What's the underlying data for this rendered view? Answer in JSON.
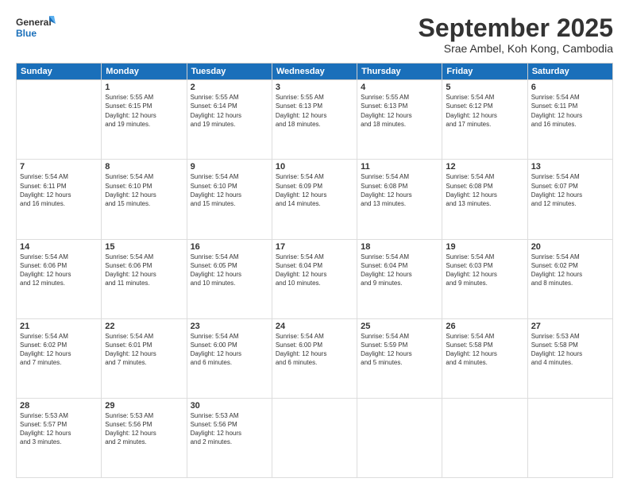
{
  "header": {
    "logo_line1": "General",
    "logo_line2": "Blue",
    "month_title": "September 2025",
    "location": "Srae Ambel, Koh Kong, Cambodia"
  },
  "weekdays": [
    "Sunday",
    "Monday",
    "Tuesday",
    "Wednesday",
    "Thursday",
    "Friday",
    "Saturday"
  ],
  "weeks": [
    [
      {
        "day": "",
        "info": ""
      },
      {
        "day": "1",
        "info": "Sunrise: 5:55 AM\nSunset: 6:15 PM\nDaylight: 12 hours\nand 19 minutes."
      },
      {
        "day": "2",
        "info": "Sunrise: 5:55 AM\nSunset: 6:14 PM\nDaylight: 12 hours\nand 19 minutes."
      },
      {
        "day": "3",
        "info": "Sunrise: 5:55 AM\nSunset: 6:13 PM\nDaylight: 12 hours\nand 18 minutes."
      },
      {
        "day": "4",
        "info": "Sunrise: 5:55 AM\nSunset: 6:13 PM\nDaylight: 12 hours\nand 18 minutes."
      },
      {
        "day": "5",
        "info": "Sunrise: 5:54 AM\nSunset: 6:12 PM\nDaylight: 12 hours\nand 17 minutes."
      },
      {
        "day": "6",
        "info": "Sunrise: 5:54 AM\nSunset: 6:11 PM\nDaylight: 12 hours\nand 16 minutes."
      }
    ],
    [
      {
        "day": "7",
        "info": "Sunrise: 5:54 AM\nSunset: 6:11 PM\nDaylight: 12 hours\nand 16 minutes."
      },
      {
        "day": "8",
        "info": "Sunrise: 5:54 AM\nSunset: 6:10 PM\nDaylight: 12 hours\nand 15 minutes."
      },
      {
        "day": "9",
        "info": "Sunrise: 5:54 AM\nSunset: 6:10 PM\nDaylight: 12 hours\nand 15 minutes."
      },
      {
        "day": "10",
        "info": "Sunrise: 5:54 AM\nSunset: 6:09 PM\nDaylight: 12 hours\nand 14 minutes."
      },
      {
        "day": "11",
        "info": "Sunrise: 5:54 AM\nSunset: 6:08 PM\nDaylight: 12 hours\nand 13 minutes."
      },
      {
        "day": "12",
        "info": "Sunrise: 5:54 AM\nSunset: 6:08 PM\nDaylight: 12 hours\nand 13 minutes."
      },
      {
        "day": "13",
        "info": "Sunrise: 5:54 AM\nSunset: 6:07 PM\nDaylight: 12 hours\nand 12 minutes."
      }
    ],
    [
      {
        "day": "14",
        "info": "Sunrise: 5:54 AM\nSunset: 6:06 PM\nDaylight: 12 hours\nand 12 minutes."
      },
      {
        "day": "15",
        "info": "Sunrise: 5:54 AM\nSunset: 6:06 PM\nDaylight: 12 hours\nand 11 minutes."
      },
      {
        "day": "16",
        "info": "Sunrise: 5:54 AM\nSunset: 6:05 PM\nDaylight: 12 hours\nand 10 minutes."
      },
      {
        "day": "17",
        "info": "Sunrise: 5:54 AM\nSunset: 6:04 PM\nDaylight: 12 hours\nand 10 minutes."
      },
      {
        "day": "18",
        "info": "Sunrise: 5:54 AM\nSunset: 6:04 PM\nDaylight: 12 hours\nand 9 minutes."
      },
      {
        "day": "19",
        "info": "Sunrise: 5:54 AM\nSunset: 6:03 PM\nDaylight: 12 hours\nand 9 minutes."
      },
      {
        "day": "20",
        "info": "Sunrise: 5:54 AM\nSunset: 6:02 PM\nDaylight: 12 hours\nand 8 minutes."
      }
    ],
    [
      {
        "day": "21",
        "info": "Sunrise: 5:54 AM\nSunset: 6:02 PM\nDaylight: 12 hours\nand 7 minutes."
      },
      {
        "day": "22",
        "info": "Sunrise: 5:54 AM\nSunset: 6:01 PM\nDaylight: 12 hours\nand 7 minutes."
      },
      {
        "day": "23",
        "info": "Sunrise: 5:54 AM\nSunset: 6:00 PM\nDaylight: 12 hours\nand 6 minutes."
      },
      {
        "day": "24",
        "info": "Sunrise: 5:54 AM\nSunset: 6:00 PM\nDaylight: 12 hours\nand 6 minutes."
      },
      {
        "day": "25",
        "info": "Sunrise: 5:54 AM\nSunset: 5:59 PM\nDaylight: 12 hours\nand 5 minutes."
      },
      {
        "day": "26",
        "info": "Sunrise: 5:54 AM\nSunset: 5:58 PM\nDaylight: 12 hours\nand 4 minutes."
      },
      {
        "day": "27",
        "info": "Sunrise: 5:53 AM\nSunset: 5:58 PM\nDaylight: 12 hours\nand 4 minutes."
      }
    ],
    [
      {
        "day": "28",
        "info": "Sunrise: 5:53 AM\nSunset: 5:57 PM\nDaylight: 12 hours\nand 3 minutes."
      },
      {
        "day": "29",
        "info": "Sunrise: 5:53 AM\nSunset: 5:56 PM\nDaylight: 12 hours\nand 2 minutes."
      },
      {
        "day": "30",
        "info": "Sunrise: 5:53 AM\nSunset: 5:56 PM\nDaylight: 12 hours\nand 2 minutes."
      },
      {
        "day": "",
        "info": ""
      },
      {
        "day": "",
        "info": ""
      },
      {
        "day": "",
        "info": ""
      },
      {
        "day": "",
        "info": ""
      }
    ]
  ]
}
